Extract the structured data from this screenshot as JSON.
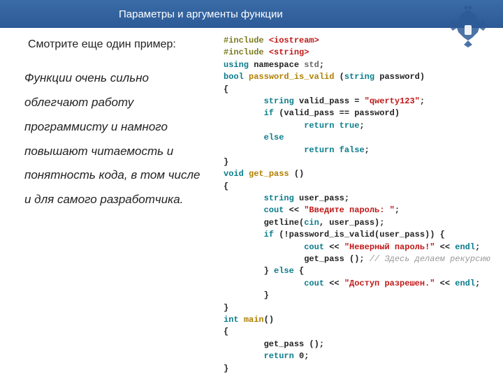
{
  "header": {
    "title": "Параметры и аргументы функции"
  },
  "intro": "Смотрите еще один пример:",
  "sidetext": "Функции очень сильно облегчают работу программисту и намного повышают читаемость и понятность кода, в том числе и для самого разработчика.",
  "code": {
    "l1a": "#include ",
    "l1b": "<iostream>",
    "l2a": "#include ",
    "l2b": "<string>",
    "l3": "",
    "l4a": "using",
    "l4b": " namespace ",
    "l4c": "std",
    "l4d": ";",
    "l5": "",
    "l6a": "bool",
    "l6b": " ",
    "l6c": "password_is_valid",
    "l6d": " (",
    "l6e": "string",
    "l6f": " password)",
    "l7": "{",
    "l8a": "        ",
    "l8b": "string",
    "l8c": " valid_pass = ",
    "l8d": "\"qwerty123\"",
    "l8e": ";",
    "l9a": "        ",
    "l9b": "if",
    "l9c": " (valid_pass == password)",
    "l10a": "                ",
    "l10b": "return",
    "l10c": " ",
    "l10d": "true",
    "l10e": ";",
    "l11a": "        ",
    "l11b": "else",
    "l12a": "                ",
    "l12b": "return",
    "l12c": " ",
    "l12d": "false",
    "l12e": ";",
    "l13": "}",
    "l14": "",
    "l15a": "void",
    "l15b": " ",
    "l15c": "get_pass",
    "l15d": " ()",
    "l16": "{",
    "l17a": "        ",
    "l17b": "string",
    "l17c": " user_pass;",
    "l18a": "        ",
    "l18b": "cout",
    "l18c": " << ",
    "l18d": "\"Введите пароль: \"",
    "l18e": ";",
    "l19a": "        getline(",
    "l19b": "cin",
    "l19c": ", user_pass);",
    "l20a": "        ",
    "l20b": "if",
    "l20c": " (!password_is_valid(user_pass)) {",
    "l21a": "                ",
    "l21b": "cout",
    "l21c": " << ",
    "l21d": "\"Неверный пароль!\"",
    "l21e": " << ",
    "l21f": "endl",
    "l21g": ";",
    "l22a": "                get_pass (); ",
    "l22b": "// Здесь делаем рекурсию",
    "l23a": "        } ",
    "l23b": "else",
    "l23c": " {",
    "l24a": "                ",
    "l24b": "cout",
    "l24c": " << ",
    "l24d": "\"Доступ разрешен.\"",
    "l24e": " << ",
    "l24f": "endl",
    "l24g": ";",
    "l25": "        }",
    "l26": "}",
    "l27": "",
    "l28a": "int",
    "l28b": " ",
    "l28c": "main",
    "l28d": "()",
    "l29": "{",
    "l30a": "        get_pass ();",
    "l31a": "        ",
    "l31b": "return",
    "l31c": " 0;",
    "l32": "}"
  }
}
